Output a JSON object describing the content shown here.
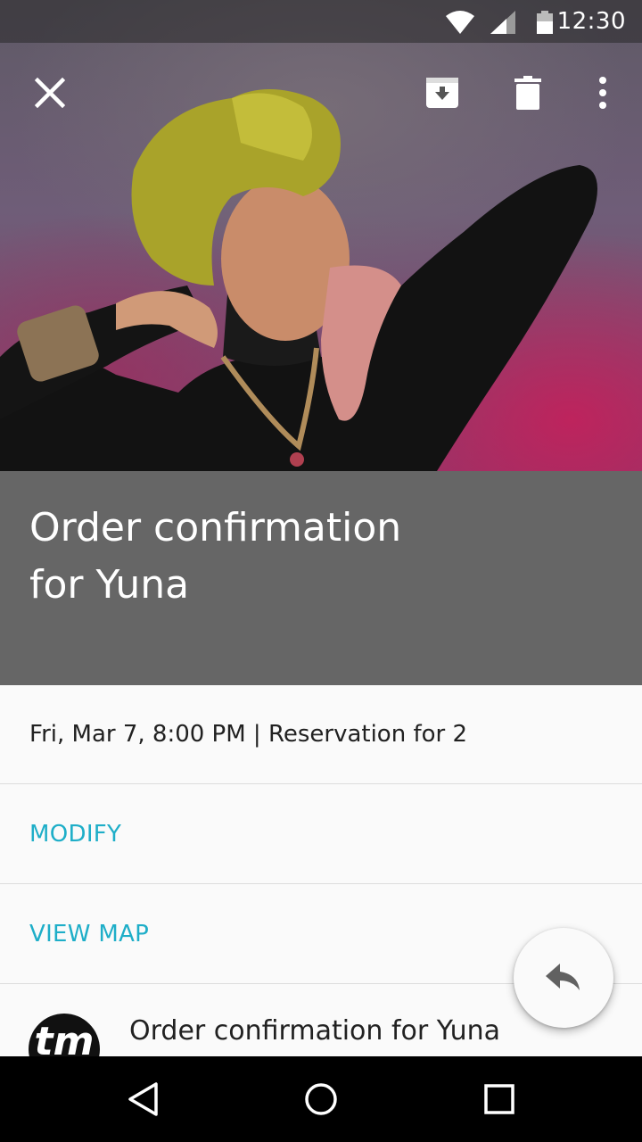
{
  "status_bar": {
    "time": "12:30"
  },
  "toolbar": {
    "close_icon": "close-icon",
    "archive_icon": "archive-icon",
    "delete_icon": "delete-icon",
    "more_icon": "more-vert-icon"
  },
  "header": {
    "title_line1": "Order confirmation",
    "title_line2": "for Yuna"
  },
  "details": {
    "summary": "Fri, Mar 7, 8:00 PM | Reservation for 2",
    "modify_label": "MODIFY",
    "view_map_label": "VIEW MAP"
  },
  "email_preview": {
    "avatar_text": "tm",
    "title": "Order confirmation for Yuna"
  },
  "fab": {
    "icon": "reply-icon"
  },
  "nav": {
    "back": "back-icon",
    "home": "home-icon",
    "recents": "recents-icon"
  },
  "colors": {
    "accent": "#1eaec8",
    "title_bg": "#666666"
  }
}
